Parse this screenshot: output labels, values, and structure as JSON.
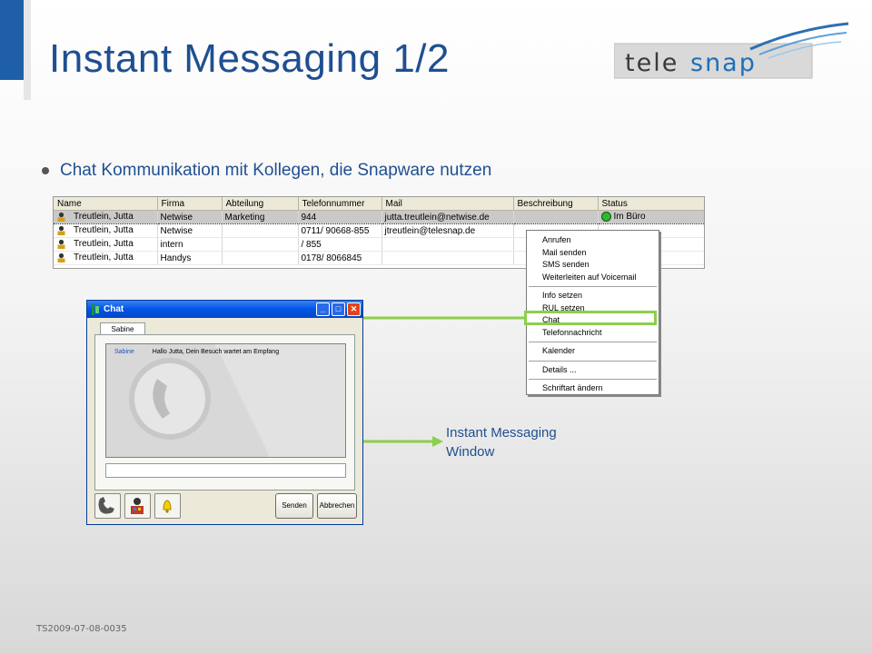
{
  "slide": {
    "title": "Instant Messaging 1/2",
    "bullet": "Chat Kommunikation mit Kollegen, die Snapware nutzen",
    "footer": "TS2009-07-08-0035",
    "logo_text": "telesnap",
    "callout_line1": "Instant Messaging",
    "callout_line2": "Window"
  },
  "contacts_table": {
    "columns": [
      "Name",
      "Firma",
      "Abteilung",
      "Telefonnummer",
      "Mail",
      "Beschreibung",
      "Status"
    ],
    "rows": [
      {
        "name": "Treutlein, Jutta",
        "firma": "Netwise",
        "abteilung": "Marketing",
        "telefon": "944",
        "mail": "jutta.treutlein@netwise.de",
        "beschreibung": "",
        "status": "Im Büro",
        "selected": true
      },
      {
        "name": "Treutlein, Jutta",
        "firma": "Netwise",
        "abteilung": "",
        "telefon": "0711/ 90668-855",
        "mail": "jtreutlein@telesnap.de",
        "beschreibung": "",
        "status": ""
      },
      {
        "name": "Treutlein, Jutta",
        "firma": "intern",
        "abteilung": "",
        "telefon": "/ 855",
        "mail": "",
        "beschreibung": "",
        "status": ""
      },
      {
        "name": "Treutlein, Jutta",
        "firma": "Handys",
        "abteilung": "",
        "telefon": "0178/ 8066845",
        "mail": "",
        "beschreibung": "",
        "status": ""
      }
    ]
  },
  "context_menu": {
    "group1": [
      "Anrufen",
      "Mail senden",
      "SMS senden",
      "Weiterleiten auf Voicemail"
    ],
    "group2": [
      "Info setzen",
      "RUL setzen",
      "Chat",
      "Telefonnachricht"
    ],
    "group3": [
      "Kalender"
    ],
    "group4": [
      "Details ..."
    ],
    "group5": [
      "Schriftart ändern"
    ],
    "highlighted": "Chat"
  },
  "chat_window": {
    "title": "Chat",
    "tab": "Sabine",
    "message_sender": "Sabine",
    "message_text": "Hallo Jutta, Dein Besuch wartet am Empfang",
    "input_value": "",
    "send_label": "Senden",
    "cancel_label": "Abbrechen"
  },
  "colors": {
    "title_blue": "#1f4f91",
    "highlight_green": "#8ccf4a",
    "status_online": "#2fb82f"
  }
}
